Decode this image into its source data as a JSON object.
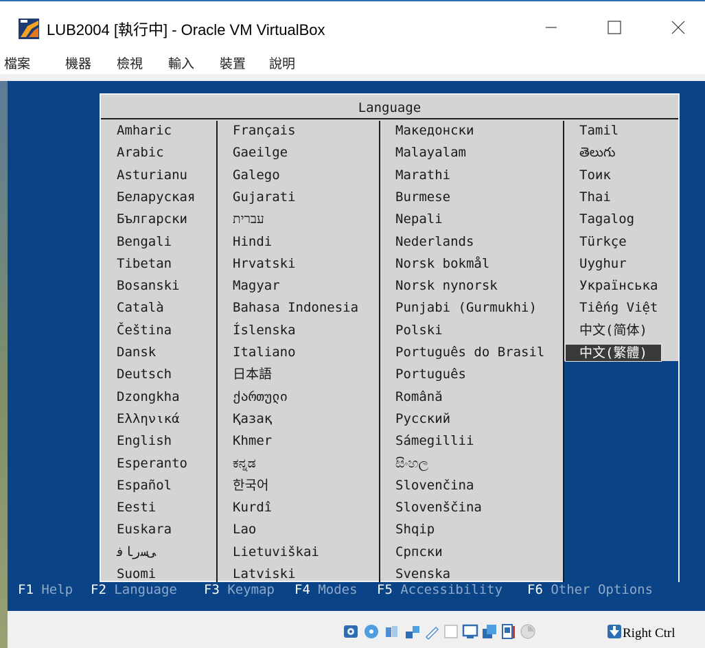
{
  "window": {
    "title": "LUB2004 [執行中] - Oracle VM VirtualBox",
    "controls": {
      "minimize_icon": "minimize-icon",
      "maximize_icon": "maximize-icon",
      "close_icon": "close-icon"
    }
  },
  "menubar": {
    "items": [
      "檔案",
      "機器",
      "檢視",
      "輸入",
      "裝置",
      "說明"
    ]
  },
  "installer": {
    "dialog_title": "Language",
    "columns": [
      [
        "Amharic",
        "Arabic",
        "Asturianu",
        "Беларуская",
        "Български",
        "Bengali",
        "Tibetan",
        "Bosanski",
        "Català",
        "Čeština",
        "Dansk",
        "Deutsch",
        "Dzongkha",
        "Ελληνικά",
        "English",
        "Esperanto",
        "Español",
        "Eesti",
        "Euskara",
        "ﻰﺳﺭﺎﻓ",
        "Suomi"
      ],
      [
        "Français",
        "Gaeilge",
        "Galego",
        "Gujarati",
        "עברית",
        "Hindi",
        "Hrvatski",
        "Magyar",
        "Bahasa Indonesia",
        "Íslenska",
        "Italiano",
        "日本語",
        "ქართული",
        "Қазақ",
        "Khmer",
        "ಕನ್ನಡ",
        "한국어",
        "Kurdî",
        "Lao",
        "Lietuviškai",
        "Latviski"
      ],
      [
        "Македонски",
        "Malayalam",
        "Marathi",
        "Burmese",
        "Nepali",
        "Nederlands",
        "Norsk bokmål",
        "Norsk nynorsk",
        "Punjabi (Gurmukhi)",
        "Polski",
        "Português do Brasil",
        "Português",
        "Română",
        "Русский",
        "Sámegillii",
        "සිංහල",
        "Slovenčina",
        "Slovenščina",
        "Shqip",
        "Српски",
        "Svenska"
      ],
      [
        "Tamil",
        "తెలుగు",
        "Тоик",
        "Thai",
        "Tagalog",
        "Türkçe",
        "Uyghur",
        "Українська",
        "Tiếng Việt",
        "中文(简体)",
        "中文(繁體)"
      ]
    ],
    "selected": "中文(繁體)",
    "function_keys": [
      {
        "key": "F1",
        "label": "Help"
      },
      {
        "key": "F2",
        "label": "Language"
      },
      {
        "key": "F3",
        "label": "Keymap"
      },
      {
        "key": "F4",
        "label": "Modes"
      },
      {
        "key": "F5",
        "label": "Accessibility"
      },
      {
        "key": "F6",
        "label": "Other Options"
      }
    ]
  },
  "statusbar": {
    "host_key": "Right Ctrl",
    "icons": [
      "hard-disk-icon",
      "optical-disc-icon",
      "audio-icon",
      "network-icon",
      "usb-icon",
      "shared-folder-icon",
      "display-icon",
      "video-capture-icon",
      "cpu-icon",
      "mouse-integration-icon",
      "keyboard-capture-icon"
    ]
  },
  "colors": {
    "vm_background": "#0a4386",
    "dialog_background": "#d4d4d4",
    "selected_background": "#3a3a3a",
    "fkey_label": "#8fa9c8"
  }
}
